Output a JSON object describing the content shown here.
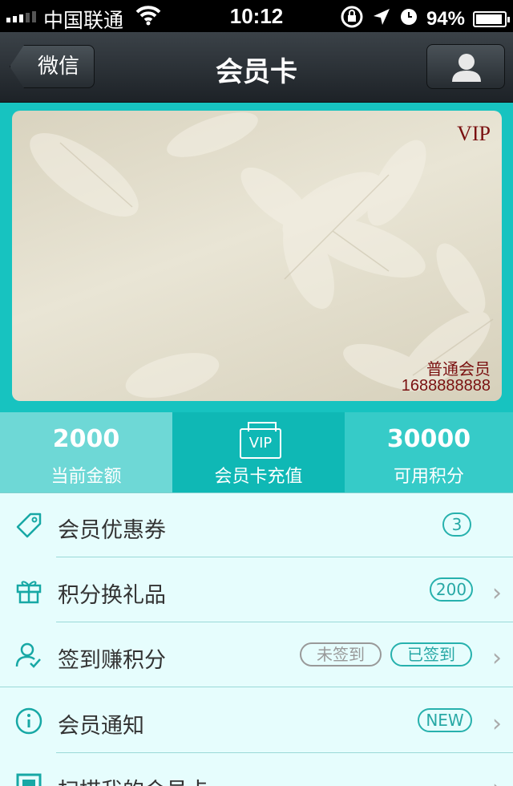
{
  "status_bar": {
    "carrier": "中国联通",
    "time": "10:12",
    "battery_percent": "94%",
    "battery_level": 0.94
  },
  "nav": {
    "back_label": "微信",
    "title": "会员卡"
  },
  "card": {
    "badge": "VIP",
    "level": "普通会员",
    "number": "1688888888"
  },
  "stats": {
    "balance": {
      "value": "2000",
      "label": "当前金额"
    },
    "recharge": {
      "icon_text": "VIP",
      "label": "会员卡充值"
    },
    "points": {
      "value": "30000",
      "label": "可用积分"
    }
  },
  "menu": {
    "coupons": {
      "label": "会员优惠券",
      "badge": "3"
    },
    "gifts": {
      "label": "积分换礼品",
      "badge": "200"
    },
    "checkin": {
      "label": "签到赚积分",
      "not_signed": "未签到",
      "signed": "已签到"
    },
    "notice": {
      "label": "会员通知",
      "badge": "NEW"
    },
    "scan": {
      "label": "扫描我的会员卡"
    }
  },
  "colors": {
    "accent": "#17c3c0",
    "card_text": "#7a1010",
    "list_bg": "#e6fdfd"
  }
}
